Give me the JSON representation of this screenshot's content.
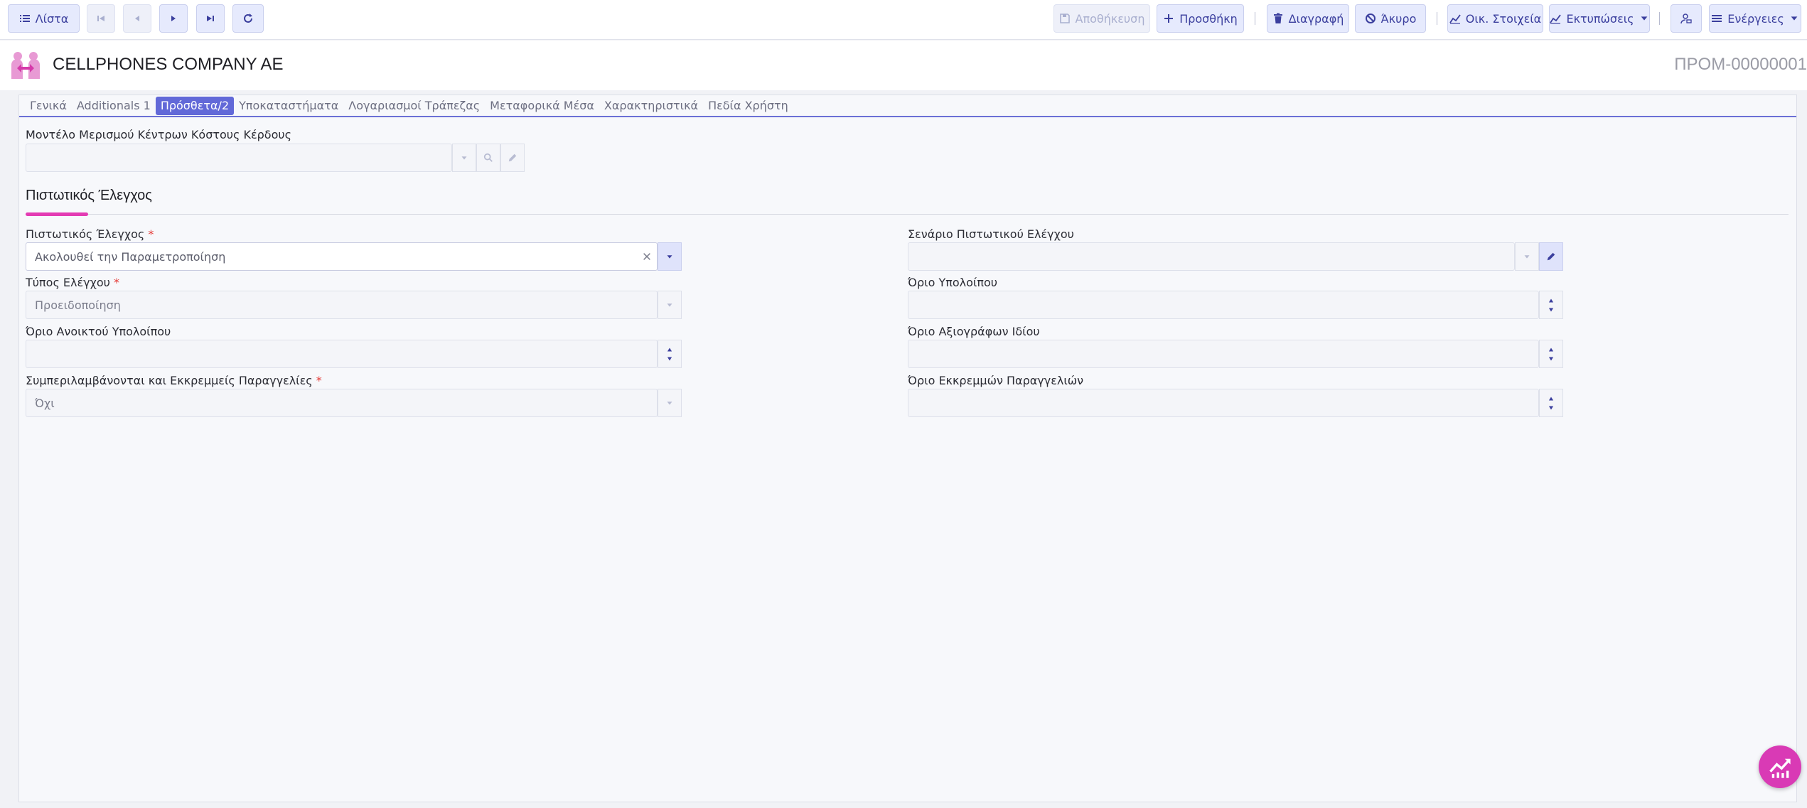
{
  "toolbar": {
    "list_label": "Λίστα",
    "save_label": "Αποθήκευση",
    "add_label": "Προσθήκη",
    "delete_label": "Διαγραφή",
    "cancel_label": "Άκυρο",
    "financials_label": "Οικ. Στοιχεία",
    "prints_label": "Εκτυπώσεις",
    "actions_label": "Ενέργειες"
  },
  "header": {
    "company": "CELLPHONES COMPANY AE",
    "code": "ΠΡΟΜ-00000001"
  },
  "tabs": [
    {
      "label": "Γενικά"
    },
    {
      "label": "Additionals 1"
    },
    {
      "label": "Πρόσθετα/2"
    },
    {
      "label": "Υποκαταστήματα"
    },
    {
      "label": "Λογαριασμοί Τράπεζας"
    },
    {
      "label": "Μεταφορικά Μέσα"
    },
    {
      "label": "Χαρακτηριστικά"
    },
    {
      "label": "Πεδία Χρήστη"
    }
  ],
  "form": {
    "cost_model_label": "Μοντέλο Μερισμού Κέντρων Κόστους Κέρδους",
    "section_title": "Πιστωτικός Έλεγχος",
    "credit_check_label": "Πιστωτικός Έλεγχος",
    "credit_check_value": "Ακολουθεί την Παραμετροποίηση",
    "control_type_label": "Τύπος Ελέγχου",
    "control_type_value": "Προειδοποίηση",
    "open_balance_limit_label": "Όριο Ανοικτού Υπολοίπου",
    "pending_orders_label": "Συμπεριλαμβάνονται και Εκκρεμμείς Παραγγελίες",
    "pending_orders_value": "Όχι",
    "scenario_label": "Σενάριο Πιστωτικού Ελέγχου",
    "balance_limit_label": "Όριο Υπολοίπου",
    "own_securities_label": "Όριο Αξιογράφων Ιδίου",
    "pending_orders_limit_label": "Όριο Εκκρεμμών Παραγγελιών",
    "required_mark": "*"
  },
  "colors": {
    "accent": "#6269d8",
    "section_accent": "#e33bb3",
    "fab": "#d93ab5"
  }
}
